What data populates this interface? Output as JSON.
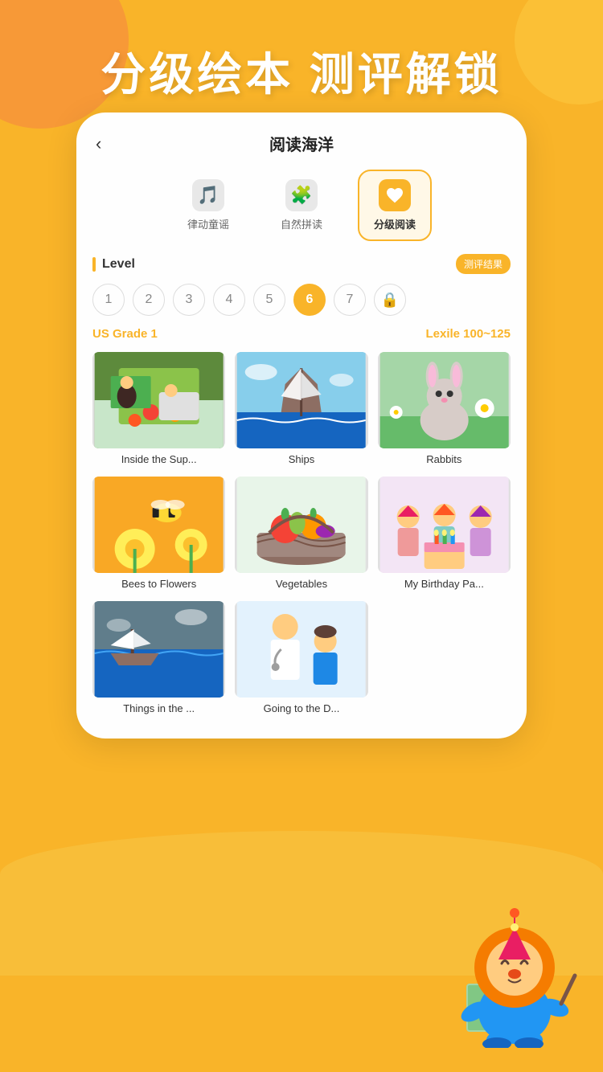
{
  "background": {
    "color": "#F9B429"
  },
  "hero": {
    "title": "分级绘本 测评解锁"
  },
  "card": {
    "back_label": "‹",
    "page_title": "阅读海洋"
  },
  "tabs": [
    {
      "id": "rhythm",
      "label": "律动童谣",
      "icon": "🎵",
      "active": false
    },
    {
      "id": "phonics",
      "label": "自然拼读",
      "icon": "🧩",
      "active": false
    },
    {
      "id": "graded",
      "label": "分级阅读",
      "icon": "♥",
      "active": true
    }
  ],
  "level": {
    "label": "Level",
    "assessment_badge": "测评结果",
    "numbers": [
      1,
      2,
      3,
      4,
      5,
      6,
      7
    ],
    "active": 6,
    "locked": 8,
    "grade_us": "US",
    "grade_label": "Grade 1",
    "lexile_label": "Lexile",
    "lexile_range": "100~125"
  },
  "books": [
    {
      "id": "supermarket",
      "title": "Inside the Sup...",
      "cover_type": "supermarket"
    },
    {
      "id": "ships",
      "title": "Ships",
      "cover_type": "ships"
    },
    {
      "id": "rabbits",
      "title": "Rabbits",
      "cover_type": "rabbits"
    },
    {
      "id": "bees",
      "title": "Bees to Flowers",
      "cover_type": "bees"
    },
    {
      "id": "vegetables",
      "title": "Vegetables",
      "cover_type": "vegetables"
    },
    {
      "id": "birthday",
      "title": "My Birthday Pa...",
      "cover_type": "birthday"
    },
    {
      "id": "things",
      "title": "Things in the ...",
      "cover_type": "things"
    },
    {
      "id": "doctor",
      "title": "Going to the D...",
      "cover_type": "doctor"
    }
  ]
}
